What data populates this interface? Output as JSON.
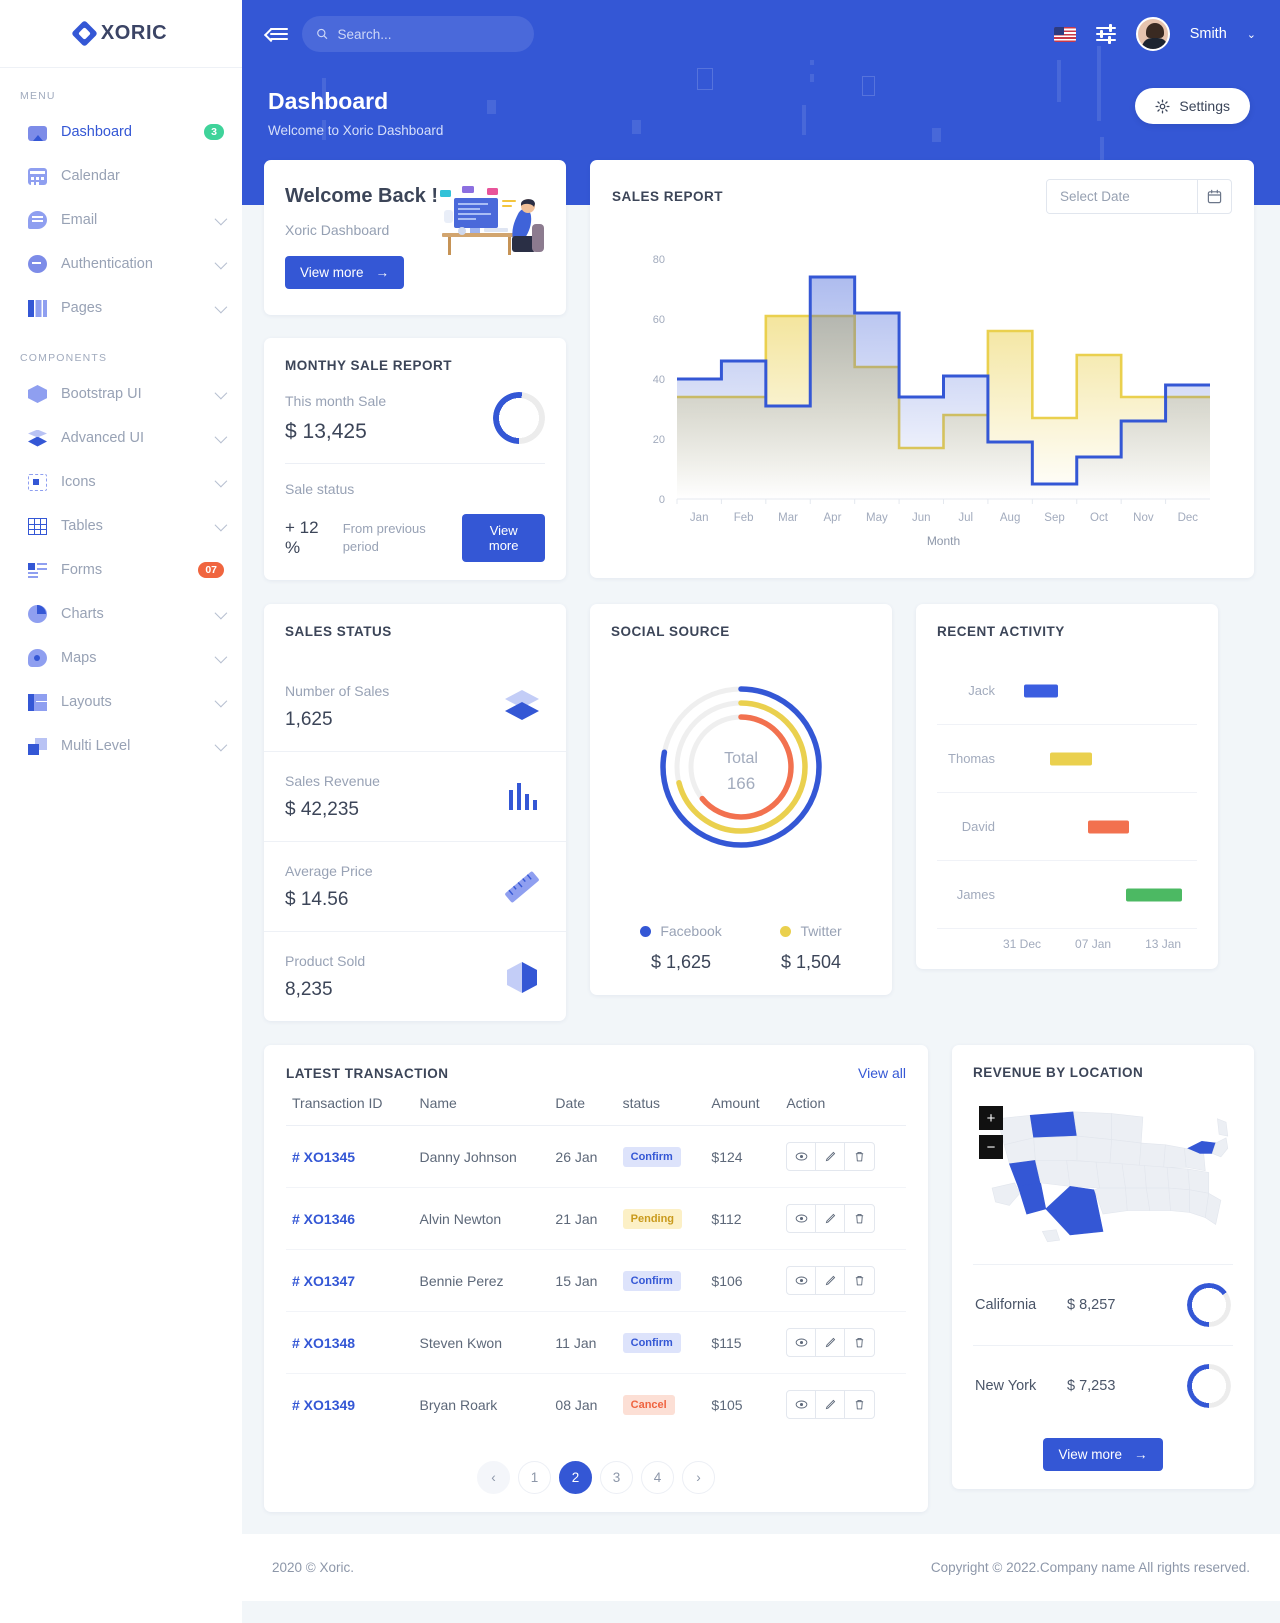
{
  "brand": {
    "name": "XORIC",
    "logo_icon": "diamond-logo-icon"
  },
  "sidebar": {
    "menu_label": "MENU",
    "components_label": "COMPONENTS",
    "menu_items": [
      {
        "label": "Dashboard",
        "icon": "dashboard-icon",
        "badge": "3",
        "badge_color": "#3fd39a",
        "active": true
      },
      {
        "label": "Calendar",
        "icon": "calendar-icon"
      },
      {
        "label": "Email",
        "icon": "email-icon",
        "chevron": true
      },
      {
        "label": "Authentication",
        "icon": "authentication-icon",
        "chevron": true
      },
      {
        "label": "Pages",
        "icon": "pages-icon",
        "chevron": true
      }
    ],
    "component_items": [
      {
        "label": "Bootstrap UI",
        "icon": "cube-icon",
        "chevron": true
      },
      {
        "label": "Advanced UI",
        "icon": "layers-icon",
        "chevron": true
      },
      {
        "label": "Icons",
        "icon": "icons-icon",
        "chevron": true
      },
      {
        "label": "Tables",
        "icon": "table-icon",
        "chevron": true
      },
      {
        "label": "Forms",
        "icon": "forms-icon",
        "badge": "07",
        "badge_color": "#f0653f"
      },
      {
        "label": "Charts",
        "icon": "pie-chart-icon",
        "chevron": true
      },
      {
        "label": "Maps",
        "icon": "map-pin-icon",
        "chevron": true
      },
      {
        "label": "Layouts",
        "icon": "layouts-icon",
        "chevron": true
      },
      {
        "label": "Multi Level",
        "icon": "multi-level-icon",
        "chevron": true
      }
    ]
  },
  "topbar": {
    "collapse_icon": "collapse-sidebar-icon",
    "search_placeholder": "Search...",
    "search_value": "",
    "search_icon": "search-icon",
    "flag_icon": "us-flag-icon",
    "settings_slider_icon": "sliders-icon",
    "user_name": "Smith",
    "user_avatar": "user-avatar",
    "chevron_icon": "chevron-down-icon"
  },
  "page": {
    "title": "Dashboard",
    "subtitle": "Welcome to Xoric Dashboard",
    "settings_label": "Settings",
    "settings_icon": "gear-icon"
  },
  "welcome": {
    "heading": "Welcome Back !",
    "subtitle": "Xoric Dashboard",
    "button": "View more",
    "arrow_icon": "arrow-right-icon"
  },
  "monthly_sale": {
    "title": "MONTHY SALE REPORT",
    "this_month_label": "This month Sale",
    "this_month_value": "$ 13,425",
    "gauge_percent": 52,
    "sale_status_label": "Sale status",
    "change": "+ 12 %",
    "change_note": "From previous period",
    "button": "View more"
  },
  "sales_report": {
    "title": "SALES REPORT",
    "date_placeholder": "Select Date",
    "date_value": "",
    "calendar_icon": "calendar-icon"
  },
  "chart_data": [
    {
      "type": "area",
      "title": "SALES REPORT",
      "xlabel": "Month",
      "ylabel": "",
      "ylim": [
        0,
        85
      ],
      "yticks": [
        0,
        20,
        40,
        60,
        80
      ],
      "categories": [
        "Jan",
        "Feb",
        "Mar",
        "Apr",
        "May",
        "Jun",
        "Jul",
        "Aug",
        "Sep",
        "Oct",
        "Nov",
        "Dec"
      ],
      "grid": false,
      "legend": "none",
      "step": true,
      "series": [
        {
          "name": "Series A",
          "color": "#3457d5",
          "values": [
            40,
            46,
            31,
            74,
            62,
            34,
            41,
            19,
            5,
            14,
            26,
            38
          ]
        },
        {
          "name": "Series B",
          "color": "#ead04e",
          "values": [
            34,
            34,
            61,
            61,
            44,
            17,
            28,
            56,
            27,
            48,
            34,
            34
          ]
        }
      ]
    },
    {
      "type": "pie",
      "title": "SOCIAL SOURCE",
      "variant": "radial",
      "center_label": "Total",
      "center_value": "166",
      "slices": [
        {
          "name": "Facebook",
          "value": 1625,
          "display": "$ 1,625",
          "percent": 78,
          "color": "#3457d5"
        },
        {
          "name": "Twitter",
          "value": 1504,
          "display": "$ 1,504",
          "percent": 71,
          "color": "#ead04e"
        },
        {
          "name": "Other",
          "value": 0,
          "display": "",
          "percent": 64,
          "color": "#f2714f"
        }
      ]
    },
    {
      "type": "bar",
      "variant": "timeline",
      "title": "RECENT ACTIVITY",
      "categories": [
        "Jack",
        "Thomas",
        "David",
        "James"
      ],
      "xticks": [
        "31 Dec",
        "07 Jan",
        "13 Jan"
      ],
      "bars": [
        {
          "name": "Jack",
          "start_pct": 8,
          "end_pct": 26,
          "color": "#3b5ee0"
        },
        {
          "name": "Thomas",
          "start_pct": 22,
          "end_pct": 44,
          "color": "#ead04e"
        },
        {
          "name": "David",
          "start_pct": 42,
          "end_pct": 64,
          "color": "#f2714f"
        },
        {
          "name": "James",
          "start_pct": 62,
          "end_pct": 92,
          "color": "#4cb963"
        }
      ]
    }
  ],
  "sales_status": {
    "title": "SALES STATUS",
    "rows": [
      {
        "label": "Number of Sales",
        "value": "1,625",
        "icon": "layers-icon"
      },
      {
        "label": "Sales Revenue",
        "value": "$ 42,235",
        "icon": "bar-chart-icon"
      },
      {
        "label": "Average Price",
        "value": "$ 14.56",
        "icon": "ruler-icon"
      },
      {
        "label": "Product Sold",
        "value": "8,235",
        "icon": "box-icon"
      }
    ]
  },
  "social_source": {
    "title": "SOCIAL SOURCE"
  },
  "recent_activity": {
    "title": "RECENT ACTIVITY"
  },
  "transactions": {
    "title": "LATEST TRANSACTION",
    "view_all": "View all",
    "columns": [
      "Transaction ID",
      "Name",
      "Date",
      "status",
      "Amount",
      "Action"
    ],
    "rows": [
      {
        "id": "# XO1345",
        "name": "Danny Johnson",
        "date": "26 Jan",
        "status": "Confirm",
        "status_type": "confirm",
        "amount": "$124"
      },
      {
        "id": "# XO1346",
        "name": "Alvin Newton",
        "date": "21 Jan",
        "status": "Pending",
        "status_type": "pending",
        "amount": "$112"
      },
      {
        "id": "# XO1347",
        "name": "Bennie Perez",
        "date": "15 Jan",
        "status": "Confirm",
        "status_type": "confirm",
        "amount": "$106"
      },
      {
        "id": "# XO1348",
        "name": "Steven Kwon",
        "date": "11 Jan",
        "status": "Confirm",
        "status_type": "confirm",
        "amount": "$115"
      },
      {
        "id": "# XO1349",
        "name": "Bryan Roark",
        "date": "08 Jan",
        "status": "Cancel",
        "status_type": "cancel",
        "amount": "$105"
      }
    ],
    "action_icons": [
      "eye-icon",
      "pencil-icon",
      "trash-icon"
    ],
    "pagination": {
      "prev": "‹",
      "next": "›",
      "pages": [
        "1",
        "2",
        "3",
        "4"
      ],
      "current": "2"
    }
  },
  "revenue_location": {
    "title": "REVENUE BY LOCATION",
    "zoom_in": "+",
    "zoom_out": "−",
    "highlighted_states": [
      "Montana",
      "California",
      "Texas",
      "New York"
    ],
    "rows": [
      {
        "name": "California",
        "value": "$ 8,257",
        "gauge_percent": 65
      },
      {
        "name": "New York",
        "value": "$ 7,253",
        "gauge_percent": 50
      }
    ],
    "button": "View more",
    "arrow_icon": "arrow-right-icon"
  },
  "footer": {
    "left": "2020 © Xoric.",
    "right": "Copyright © 2022.Company name All rights reserved."
  },
  "colors": {
    "primary": "#3457d5",
    "yellow": "#ead04e",
    "red": "#f2714f",
    "green": "#4cb963"
  }
}
